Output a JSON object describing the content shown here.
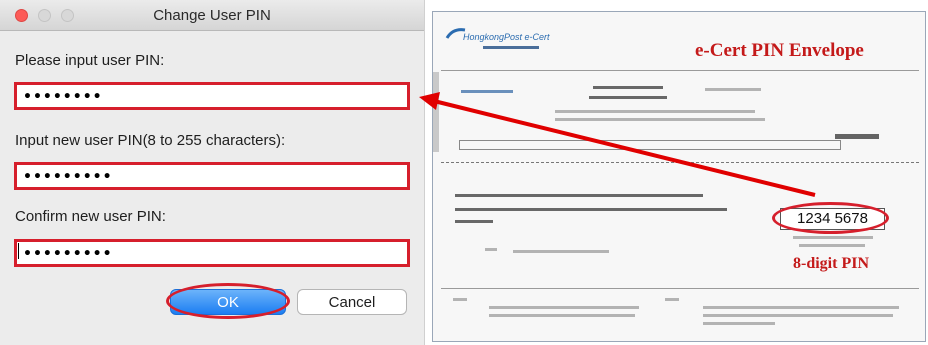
{
  "dialog": {
    "title": "Change User PIN",
    "fields": [
      {
        "label": "Please input user PIN:",
        "value_masked": "••••••••"
      },
      {
        "label": "Input new user PIN(8 to 255 characters):",
        "value_masked": "•••••••••"
      },
      {
        "label": "Confirm new user PIN:",
        "value_masked": "•••••••••"
      }
    ],
    "ok_label": "OK",
    "cancel_label": "Cancel"
  },
  "envelope": {
    "brand": "HongkongPost e-Cert",
    "heading": "e-Cert PIN Envelope",
    "sample_pin": "1234 5678",
    "pin_label": "8-digit PIN"
  },
  "colors": {
    "highlight": "#d61f2c",
    "ok_button": "#1c7ef2",
    "envelope_heading": "#c41a1a"
  },
  "icons": [
    "close-icon",
    "minimize-icon",
    "maximize-icon",
    "pointer-arrow"
  ]
}
